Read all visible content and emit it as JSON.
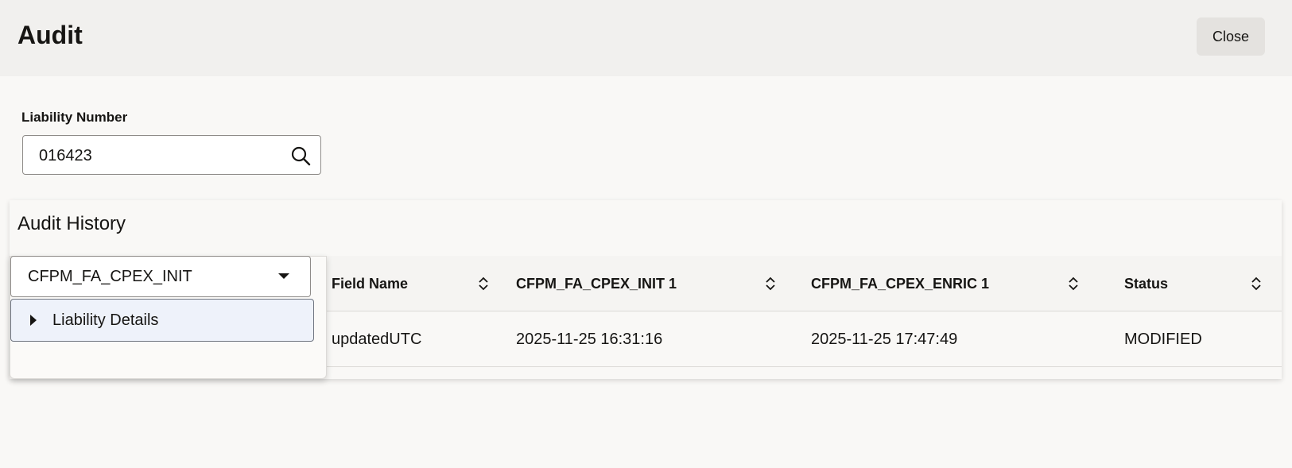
{
  "header": {
    "title": "Audit",
    "close_label": "Close"
  },
  "liability": {
    "label": "Liability Number",
    "value": "016423",
    "search_icon": "search-icon"
  },
  "history": {
    "title": "Audit History",
    "version_select": {
      "value": "CFPM_FA_CPEX_INIT",
      "icon": "caret-down-icon"
    },
    "tree": [
      {
        "label": "Liability Details",
        "icon": "caret-right-icon",
        "expanded": false
      }
    ],
    "table": {
      "columns": [
        "Field Name",
        "CFPM_FA_CPEX_INIT 1",
        "CFPM_FA_CPEX_ENRIC 1",
        "Status"
      ],
      "rows": [
        [
          "updatedUTC",
          "2025-11-25 16:31:16",
          "2025-11-25 17:47:49",
          "MODIFIED"
        ]
      ]
    }
  }
}
